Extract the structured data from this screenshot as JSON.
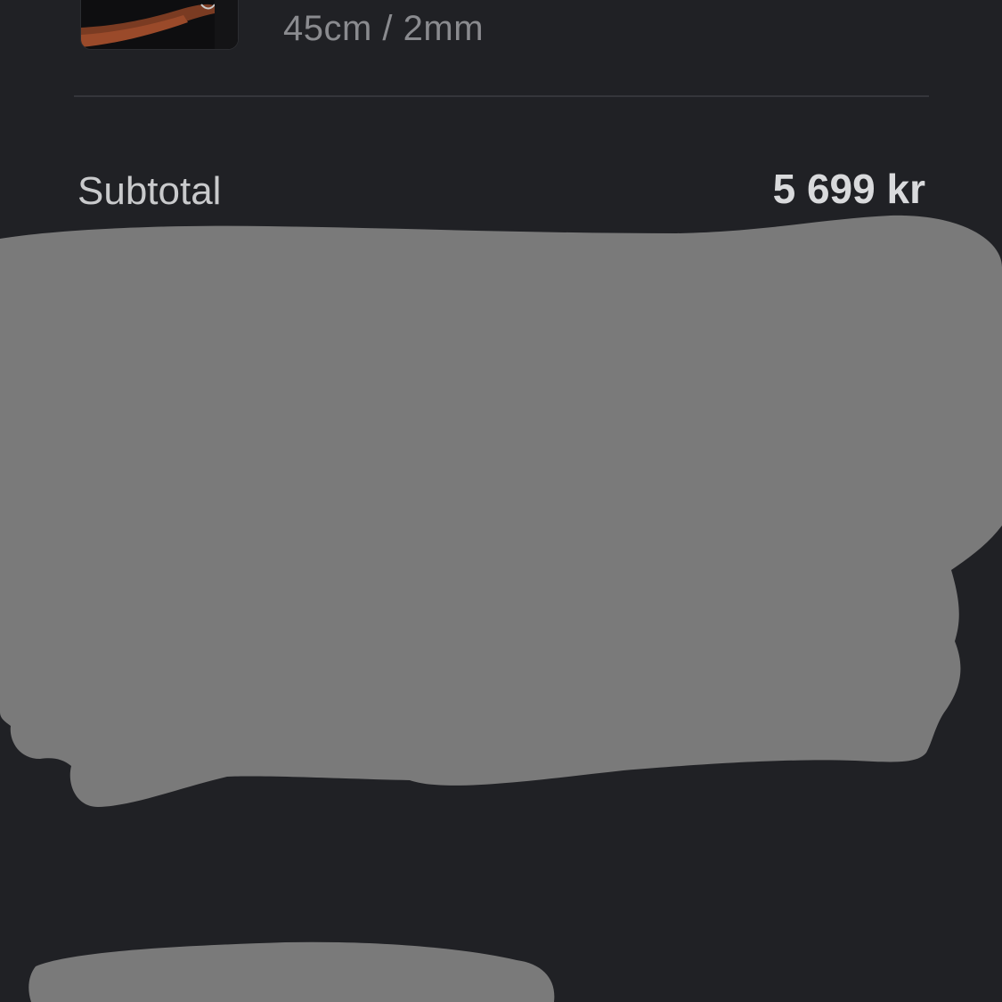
{
  "cart_item": {
    "variant": "45cm / 2mm",
    "thumbnail": "product-photo"
  },
  "summary": {
    "subtotal_label": "Subtotal",
    "subtotal_value": "5 699 kr"
  },
  "colors": {
    "background": "#202125",
    "divider": "#35363b",
    "redaction": "#7a7a7a"
  }
}
